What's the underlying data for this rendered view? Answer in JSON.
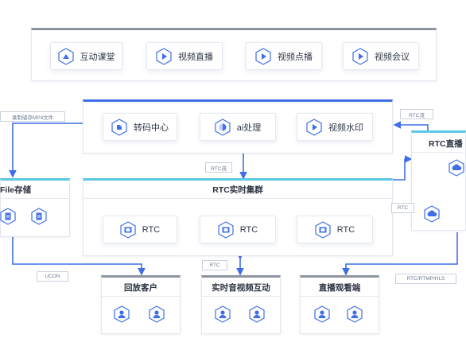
{
  "top": {
    "items": [
      {
        "label": "互动课堂",
        "icon": "classroom-icon"
      },
      {
        "label": "视频直播",
        "icon": "play-icon"
      },
      {
        "label": "视频点播",
        "icon": "play-icon"
      },
      {
        "label": "视频会议",
        "icon": "play-icon"
      }
    ]
  },
  "processing": {
    "items": [
      {
        "label": "转码中心",
        "icon": "transcode-icon"
      },
      {
        "label": "ai处理",
        "icon": "ai-icon"
      },
      {
        "label": "视频水印",
        "icon": "play-icon"
      }
    ]
  },
  "rtc_cluster": {
    "title": "RTC实时集群",
    "nodes": [
      "RTC",
      "RTC",
      "RTC"
    ]
  },
  "file_storage": {
    "title": "File存储"
  },
  "rtc_live": {
    "title": "RTC直播"
  },
  "clients": [
    {
      "title": "回放客户"
    },
    {
      "title": "实时音视频互动"
    },
    {
      "title": "直播观看端"
    }
  ],
  "labels": {
    "record": "录制储存MP4文件",
    "rtc_flow_top": "RTC流",
    "rtc_flow_mid": "RTC流",
    "rtc_right": "RTC",
    "ucon": "UCON",
    "rtc_bottom": "RTC",
    "rtmp": "RTC/RTMP/HLS"
  },
  "colors": {
    "primary": "#3f6ee8",
    "cyan": "#5bc8e6",
    "icon": "#3f6ee8"
  }
}
